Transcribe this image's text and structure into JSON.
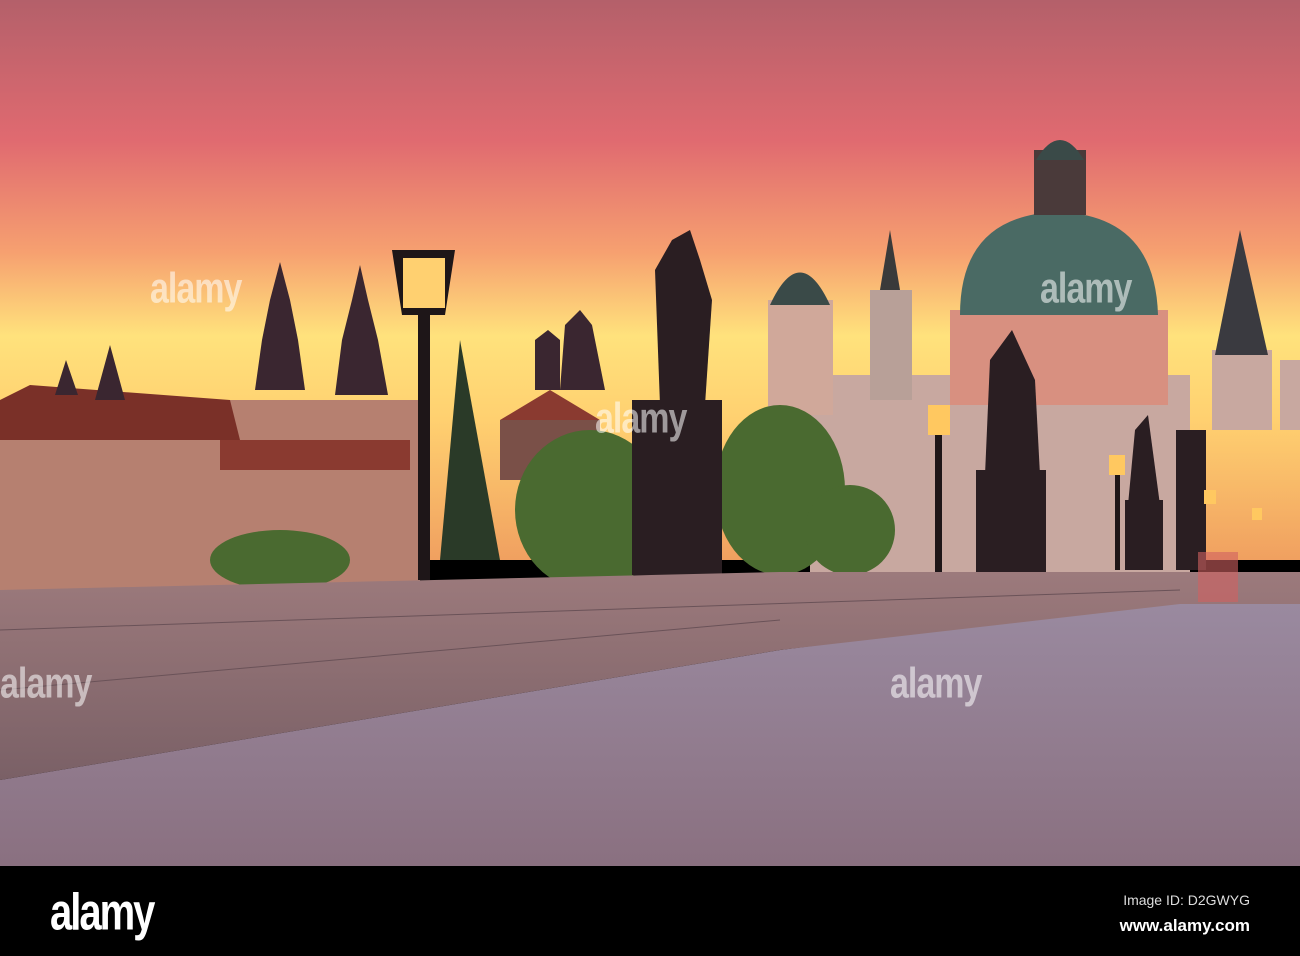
{
  "photo": {
    "subject": "Charles Bridge at sunrise, Prague",
    "colors": {
      "sky_top": "#c26a6e",
      "sky_mid": "#f27a6a",
      "sky_glow": "#ffe07a",
      "silhouette": "#2a1e22",
      "stone": "#8e7478",
      "cobble": "#9c8596"
    }
  },
  "watermark": {
    "text": "alamy"
  },
  "footer": {
    "logo": "alamy",
    "image_id": "Image ID: D2GWYG",
    "site": "www.alamy.com"
  }
}
